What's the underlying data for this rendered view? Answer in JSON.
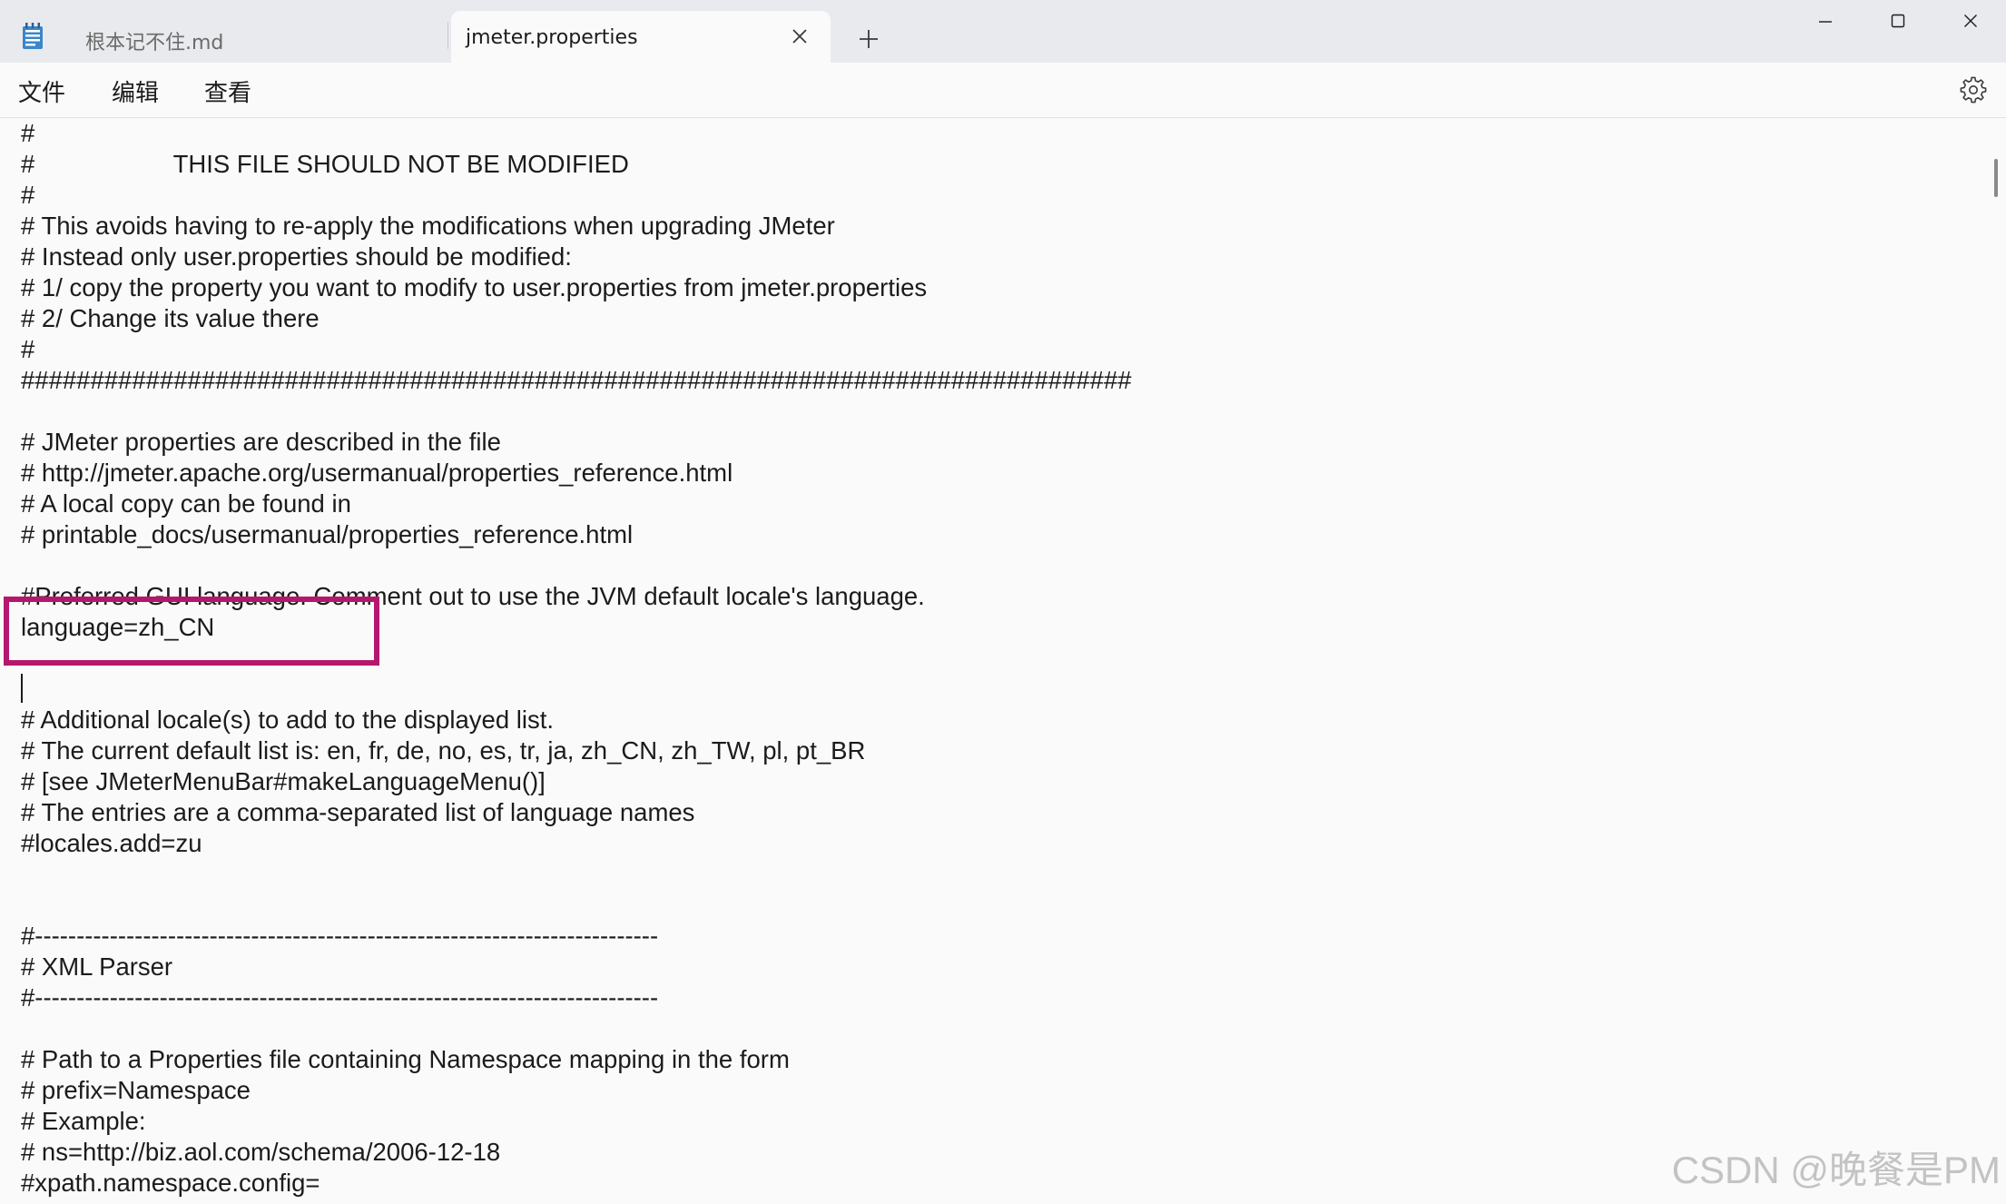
{
  "tabs": [
    {
      "label": "根本记不住.md",
      "active": false
    },
    {
      "label": "jmeter.properties",
      "active": true
    }
  ],
  "menu": {
    "file": "文件",
    "edit": "编辑",
    "view": "查看"
  },
  "icons": {
    "app": "notepad-icon",
    "close_tab": "close-icon",
    "new_tab": "plus-icon",
    "settings": "gear-icon",
    "minimize": "minimize-icon",
    "maximize": "maximize-icon",
    "close_window": "close-icon"
  },
  "colors": {
    "highlight_border": "#b5176e",
    "titlebar": "#e8eaed",
    "editor_background": "#fafafa"
  },
  "editor": {
    "lines": [
      "#",
      "#                    THIS FILE SHOULD NOT BE MODIFIED",
      "#",
      "# This avoids having to re-apply the modifications when upgrading JMeter",
      "# Instead only user.properties should be modified:",
      "# 1/ copy the property you want to modify to user.properties from jmeter.properties",
      "# 2/ Change its value there",
      "#",
      "################################################################################",
      "",
      "# JMeter properties are described in the file",
      "# http://jmeter.apache.org/usermanual/properties_reference.html",
      "# A local copy can be found in",
      "# printable_docs/usermanual/properties_reference.html",
      "",
      "#Preferred GUI language. Comment out to use the JVM default locale's language.",
      "language=zh_CN",
      "",
      "",
      "# Additional locale(s) to add to the displayed list.",
      "# The current default list is: en, fr, de, no, es, tr, ja, zh_CN, zh_TW, pl, pt_BR",
      "# [see JMeterMenuBar#makeLanguageMenu()]",
      "# The entries are a comma-separated list of language names",
      "#locales.add=zu",
      "",
      "",
      "#---------------------------------------------------------------------------",
      "# XML Parser",
      "#---------------------------------------------------------------------------",
      "",
      "# Path to a Properties file containing Namespace mapping in the form",
      "# prefix=Namespace",
      "# Example:",
      "# ns=http://biz.aol.com/schema/2006-12-18",
      "#xpath.namespace.config="
    ]
  },
  "watermark": "CSDN @晚餐是PM"
}
